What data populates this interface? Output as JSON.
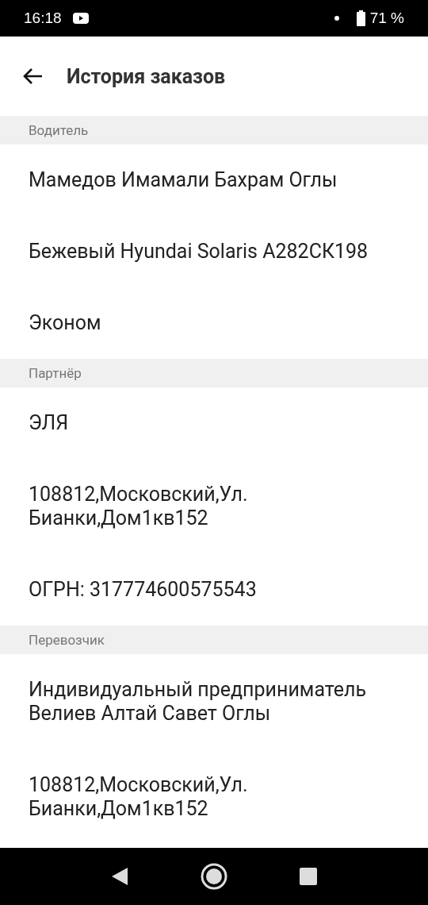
{
  "status_bar": {
    "time": "16:18",
    "battery": "71 %"
  },
  "header": {
    "title": "История заказов"
  },
  "sections": [
    {
      "title": "Водитель",
      "rows": [
        "Мамедов Имамали Бахрам Оглы",
        "Бежевый Hyundai Solaris А282СК198",
        "Эконом"
      ]
    },
    {
      "title": "Партнёр",
      "rows": [
        "ЭЛЯ",
        "108812,Московский,Ул. Бианки,Дом1кв152",
        "ОГРН: 317774600575543"
      ]
    },
    {
      "title": "Перевозчик",
      "rows": [
        "Индивидуальный предприниматель Велиев Алтай Савет Оглы",
        "108812,Московский,Ул. Бианки,Дом1кв152"
      ]
    }
  ]
}
